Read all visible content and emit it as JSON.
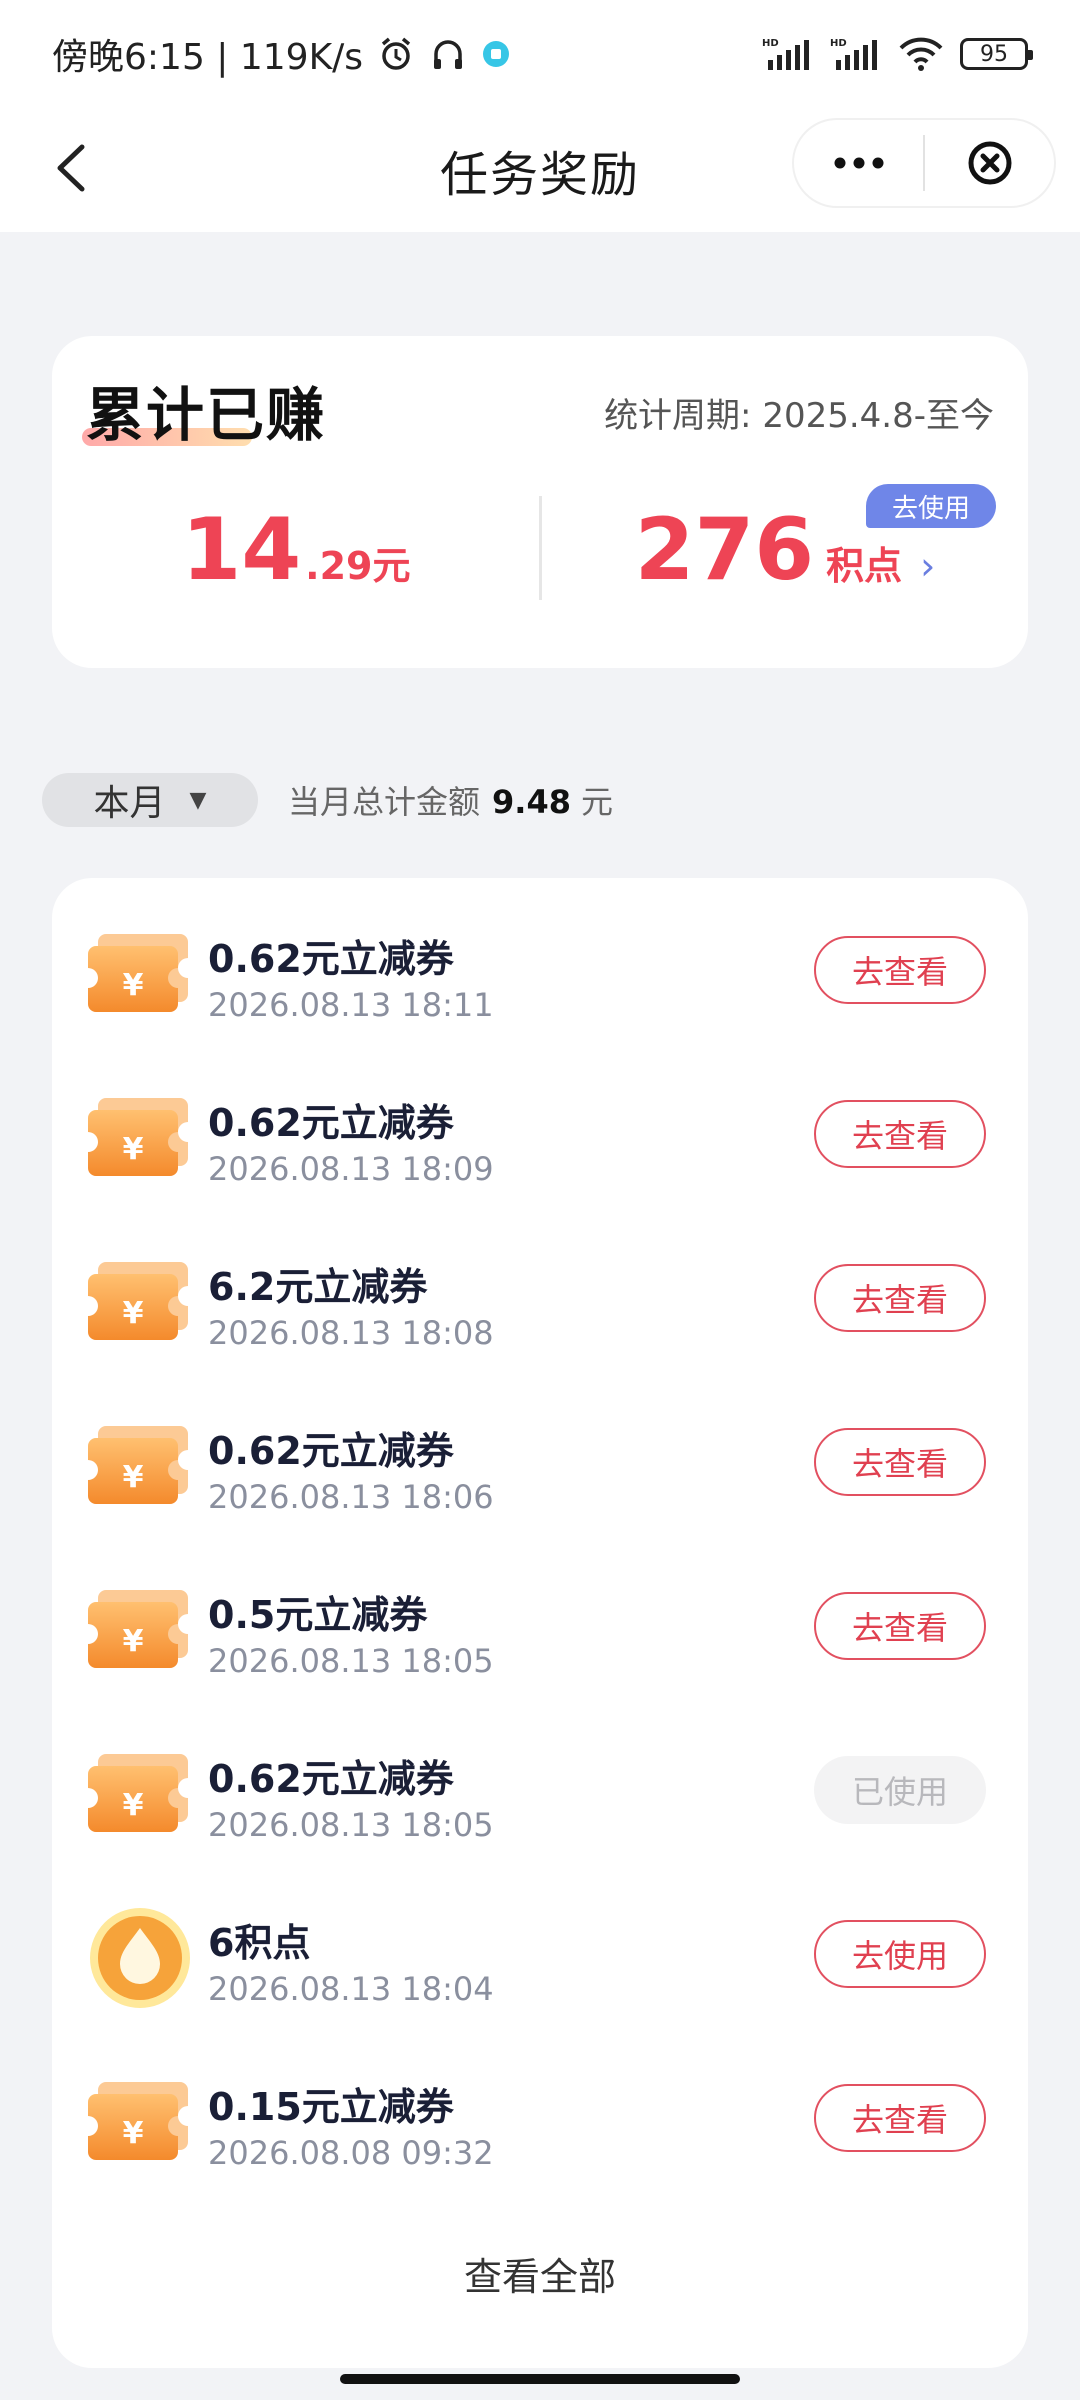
{
  "status_bar": {
    "time": "傍晚6:15 | 119K/s",
    "battery": "95",
    "icons": [
      "alarm-icon",
      "headphones-icon",
      "app-notification-icon",
      "signal-hd-icon",
      "signal-hd-icon",
      "wifi-icon",
      "battery-icon"
    ]
  },
  "nav": {
    "title": "任务奖励",
    "back_icon": "back-arrow-icon",
    "more_icon": "more-dots-icon",
    "close_icon": "close-circle-icon"
  },
  "summary": {
    "title": "累计已赚",
    "period": "统计周期: 2025.4.8-至今",
    "money_int": "14",
    "money_dec": ".29元",
    "points_value": "276",
    "points_unit": "积点",
    "points_chevron": "›",
    "use_badge": "去使用"
  },
  "filter": {
    "month_label": "本月",
    "caret": "▼",
    "total_label": "当月总计金额",
    "total_value": "9.48",
    "total_unit": "元"
  },
  "rewards": [
    {
      "title": "0.62元立减券",
      "time": "2026.08.13 18:11",
      "action": "去查看",
      "type": "coupon",
      "used": false
    },
    {
      "title": "0.62元立减券",
      "time": "2026.08.13 18:09",
      "action": "去查看",
      "type": "coupon",
      "used": false
    },
    {
      "title": "6.2元立减券",
      "time": "2026.08.13 18:08",
      "action": "去查看",
      "type": "coupon",
      "used": false
    },
    {
      "title": "0.62元立减券",
      "time": "2026.08.13 18:06",
      "action": "去查看",
      "type": "coupon",
      "used": false
    },
    {
      "title": "0.5元立减券",
      "time": "2026.08.13 18:05",
      "action": "去查看",
      "type": "coupon",
      "used": false
    },
    {
      "title": "0.62元立减券",
      "time": "2026.08.13 18:05",
      "action": "已使用",
      "type": "coupon",
      "used": true
    },
    {
      "title": "6积点",
      "time": "2026.08.13 18:04",
      "action": "去使用",
      "type": "points",
      "used": false
    },
    {
      "title": "0.15元立减券",
      "time": "2026.08.08 09:32",
      "action": "去查看",
      "type": "coupon",
      "used": false
    }
  ],
  "view_all": "查看全部",
  "colors": {
    "accent_red": "#ee4455",
    "badge_blue": "#6f86e8",
    "coupon_orange": "#f7a042",
    "page_bg": "#f2f3f6"
  }
}
